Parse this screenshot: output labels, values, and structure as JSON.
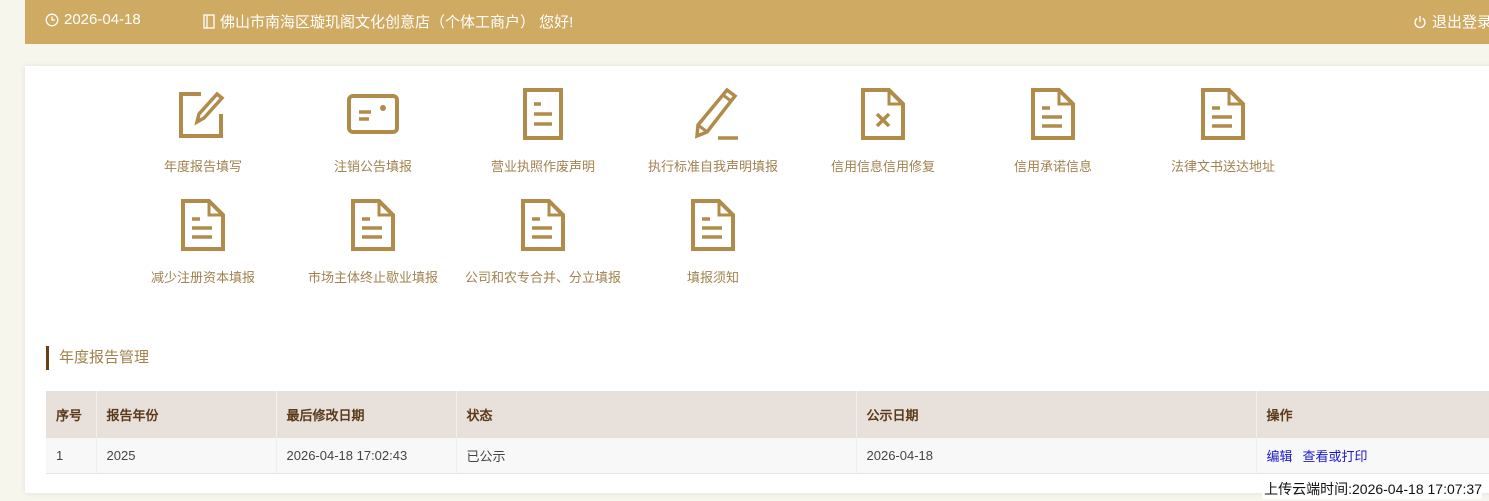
{
  "header": {
    "date": "2026-04-18",
    "greeting": "佛山市南海区璇玑阁文化创意店（个体工商户） 您好!",
    "logout": "退出登录"
  },
  "tiles": [
    {
      "label": "年度报告填写",
      "icon": "edit-icon"
    },
    {
      "label": "注销公告填报",
      "icon": "card-icon"
    },
    {
      "label": "营业执照作废声明",
      "icon": "document-icon"
    },
    {
      "label": "执行标准自我声明填报",
      "icon": "pencil-icon"
    },
    {
      "label": "信用信息信用修复",
      "icon": "file-x-icon"
    },
    {
      "label": "信用承诺信息",
      "icon": "file-icon"
    },
    {
      "label": "法律文书送达地址",
      "icon": "file-icon"
    },
    {
      "label": "减少注册资本填报",
      "icon": "file-icon"
    },
    {
      "label": "市场主体终止歇业填报",
      "icon": "file-icon"
    },
    {
      "label": "公司和农专合并、分立填报",
      "icon": "file-icon"
    },
    {
      "label": "填报须知",
      "icon": "file-icon"
    }
  ],
  "section_title": "年度报告管理",
  "table": {
    "headers": [
      "序号",
      "报告年份",
      "最后修改日期",
      "状态",
      "公示日期",
      "操作"
    ],
    "rows": [
      {
        "no": "1",
        "year": "2025",
        "modified": "2026-04-18 17:02:43",
        "status": "已公示",
        "published": "2026-04-18",
        "actions": [
          "编辑",
          "查看或打印"
        ]
      }
    ]
  },
  "upload_time": "上传云端时间:2026-04-18 17:07:37",
  "colors": {
    "header_bg": "#cfaa62",
    "icon": "#b08b4a",
    "table_header_bg": "#e8e0da"
  }
}
